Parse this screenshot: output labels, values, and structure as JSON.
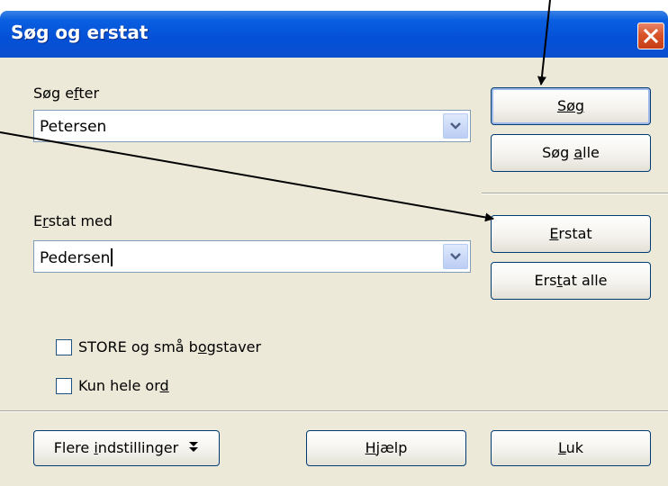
{
  "dialog": {
    "title": "Søg og erstat"
  },
  "search": {
    "label": "Søg efter",
    "value": "Petersen"
  },
  "replace": {
    "label": "Erstat med",
    "value": "Pedersen"
  },
  "buttons": {
    "find": "Søg",
    "find_all": "Søg alle",
    "replace": "Erstat",
    "replace_all": "Erstat alle",
    "more_options": "Flere indstillinger",
    "help": "Hjælp",
    "close": "Luk"
  },
  "options": {
    "match_case": {
      "label": "STORE og små bogstaver",
      "checked": false
    },
    "whole_words": {
      "label": "Kun hele ord",
      "checked": false
    }
  },
  "colors": {
    "titlebar": "#0450d6",
    "dialog_bg": "#ece9d8",
    "close": "#d9542a"
  }
}
